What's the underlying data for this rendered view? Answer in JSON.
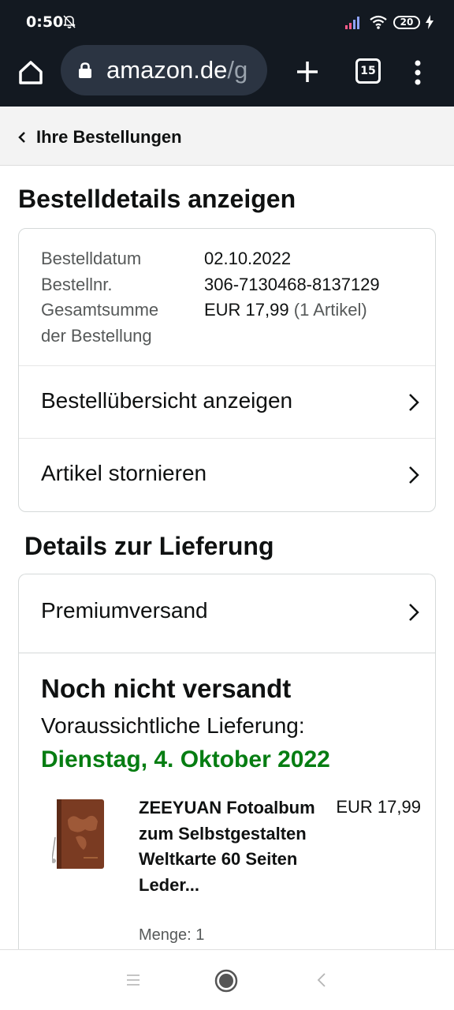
{
  "status_bar": {
    "time": "0:50",
    "battery": "20",
    "icons": [
      "bell-off-icon",
      "signal-icon",
      "wifi-icon",
      "battery-icon",
      "charging-icon"
    ]
  },
  "browser": {
    "url_host": "amazon.de",
    "url_path": "/g",
    "tab_count": "15",
    "icons": [
      "home-icon",
      "lock-icon",
      "plus-icon",
      "tabs-icon",
      "more-vert-icon"
    ]
  },
  "breadcrumb": {
    "label": "Ihre Bestellungen"
  },
  "page": {
    "title": "Bestelldetails anzeigen"
  },
  "order": {
    "date_label": "Bestelldatum",
    "date_value": "02.10.2022",
    "number_label": "Bestellnr.",
    "number_value": "306-7130468-8137129",
    "total_label_line1": "Gesamtsumme",
    "total_label_line2": "der Bestellung",
    "total_value": "EUR 17,99",
    "total_items": "(1 Artikel)"
  },
  "actions": {
    "overview": "Bestellübersicht anzeigen",
    "cancel": "Artikel stornieren"
  },
  "delivery": {
    "section_title": "Details zur Lieferung",
    "shipping_method": "Premiumversand",
    "status": "Noch nicht versandt",
    "eta_label": "Voraussichtliche Lieferung:",
    "eta_date": "Dienstag, 4. Oktober 2022"
  },
  "item": {
    "title": "ZEEYUAN Fotoalbum zum Selbstgestalten Weltkarte 60 Seiten Leder...",
    "price": "EUR 17,99",
    "quantity": "Menge: 1"
  },
  "colors": {
    "header_bg": "#131921",
    "delivery_green": "#067d12",
    "text": "#0f1111",
    "muted": "#565959"
  }
}
